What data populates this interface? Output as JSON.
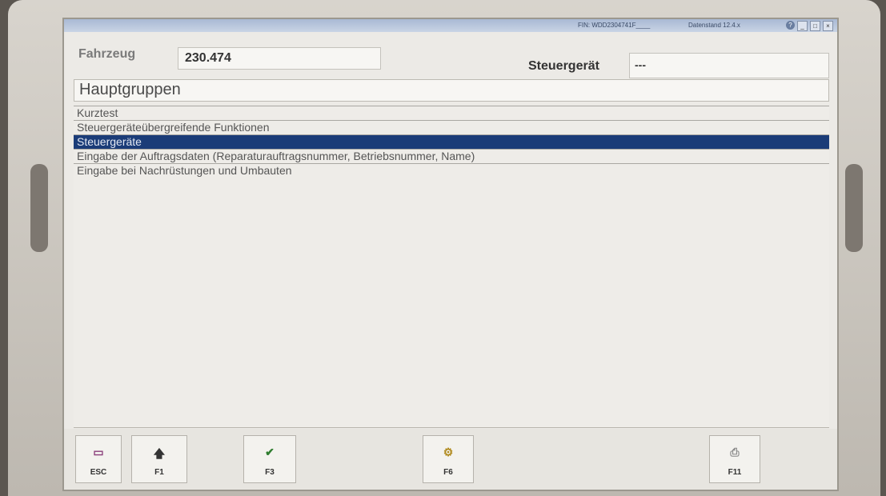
{
  "window": {
    "title": "",
    "fin": "FIN: WDD2304741F____",
    "data_status": "Datenstand 12.4.x",
    "buttons": [
      "_",
      "□",
      "×"
    ]
  },
  "header": {
    "fahrzeug_label": "Fahrzeug",
    "fahrzeug_value": "230.474",
    "steuergeraet_label": "Steuergerät",
    "steuergeraet_value": "---"
  },
  "group_title": "Hauptgruppen",
  "menu_items": [
    {
      "label": "Kurztest",
      "selected": false
    },
    {
      "label": "Steuergeräteübergreifende Funktionen",
      "selected": false
    },
    {
      "label": "Steuergeräte",
      "selected": true
    },
    {
      "label": "Eingabe der Auftragsdaten (Reparaturauftragsnummer, Betriebsnummer, Name)",
      "selected": false
    },
    {
      "label": "Eingabe bei Nachrüstungen und Umbauten",
      "selected": false
    }
  ],
  "toolbar": {
    "esc": {
      "key": "ESC",
      "icon": "exit-door-icon"
    },
    "f1": {
      "key": "F1",
      "icon": "up-arrow-icon"
    },
    "f3": {
      "key": "F3",
      "icon": "checkmark-icon"
    },
    "f6": {
      "key": "F6",
      "icon": "tools-icon"
    },
    "f11": {
      "key": "F11",
      "icon": "printer-icon"
    }
  },
  "colors": {
    "selection": "#1b3c78",
    "background": "#eceae6"
  }
}
